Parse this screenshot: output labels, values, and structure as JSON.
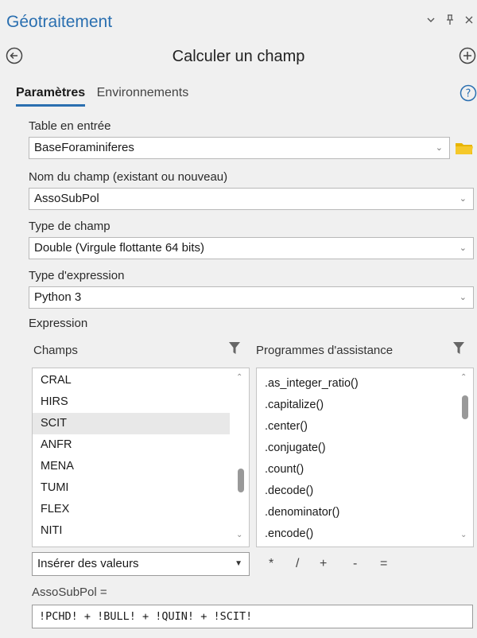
{
  "header": {
    "title": "Géotraitement",
    "page_title": "Calculer un champ",
    "window_controls": [
      "chevron-down-icon",
      "pin-icon",
      "close-icon"
    ]
  },
  "tabs": [
    {
      "label": "Paramètres",
      "active": true
    },
    {
      "label": "Environnements",
      "active": false
    }
  ],
  "params": {
    "input_table": {
      "label": "Table en entrée",
      "value": "BaseForaminiferes"
    },
    "field_name": {
      "label": "Nom du champ (existant ou nouveau)",
      "value": "AssoSubPol"
    },
    "field_type": {
      "label": "Type de champ",
      "value": "Double (Virgule flottante 64 bits)"
    },
    "expression_type": {
      "label": "Type d'expression",
      "value": "Python 3"
    }
  },
  "expression": {
    "label": "Expression",
    "fields_header": "Champs",
    "helpers_header": "Programmes d'assistance",
    "fields": [
      "CRAL",
      "HIRS",
      "SCIT",
      "ANFR",
      "MENA",
      "TUMI",
      "FLEX",
      "NITI"
    ],
    "selected_field": "SCIT",
    "helpers": [
      ".as_integer_ratio()",
      ".capitalize()",
      ".center()",
      ".conjugate()",
      ".count()",
      ".decode()",
      ".denominator()",
      ".encode()"
    ],
    "insert_values": "Insérer des valeurs",
    "operators": [
      "*",
      "/",
      "+",
      "-",
      "="
    ],
    "target_label": "AssoSubPol =",
    "code": "!PCHD! + !BULL! + !QUIN! + !SCIT!"
  },
  "colors": {
    "accent": "#2a6fb0",
    "panel_bg": "#f0f0f0",
    "folder": "#e8b400"
  }
}
